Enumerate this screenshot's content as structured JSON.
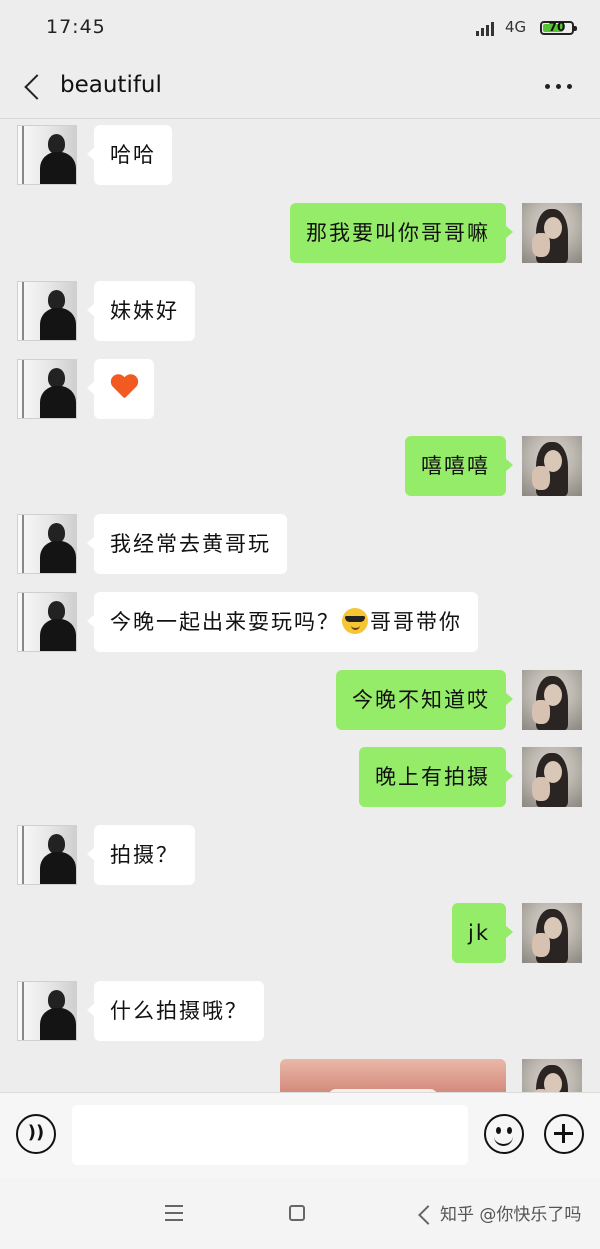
{
  "status": {
    "time": "17:45",
    "network": "4G",
    "battery": "70",
    "battery_level": 0.7
  },
  "header": {
    "title": "beautiful"
  },
  "messages": [
    {
      "side": "left",
      "text": "哈哈"
    },
    {
      "side": "right",
      "text": "那我要叫你哥哥嘛"
    },
    {
      "side": "left",
      "text": "妹妹好"
    },
    {
      "side": "left",
      "type": "emoji",
      "emoji": "heart-icon"
    },
    {
      "side": "right",
      "text": "嘻嘻嘻"
    },
    {
      "side": "left",
      "text": "我经常去黄哥玩"
    },
    {
      "side": "left",
      "text_before": "今晚一起出来耍玩吗？",
      "emoji": "sunglasses-smiley",
      "text_after": "哥哥带你"
    },
    {
      "side": "right",
      "text": "今晚不知道哎"
    },
    {
      "side": "right",
      "text": "晚上有拍摄"
    },
    {
      "side": "left",
      "text": "拍摄？"
    },
    {
      "side": "right",
      "text": "jk"
    },
    {
      "side": "left",
      "text": "什么拍摄哦？"
    },
    {
      "side": "right",
      "type": "image"
    }
  ],
  "input": {
    "placeholder": ""
  },
  "watermark": "知乎 @你快乐了吗",
  "colors": {
    "sent_bubble": "#95ec69",
    "received_bubble": "#ffffff",
    "background": "#ededed"
  }
}
